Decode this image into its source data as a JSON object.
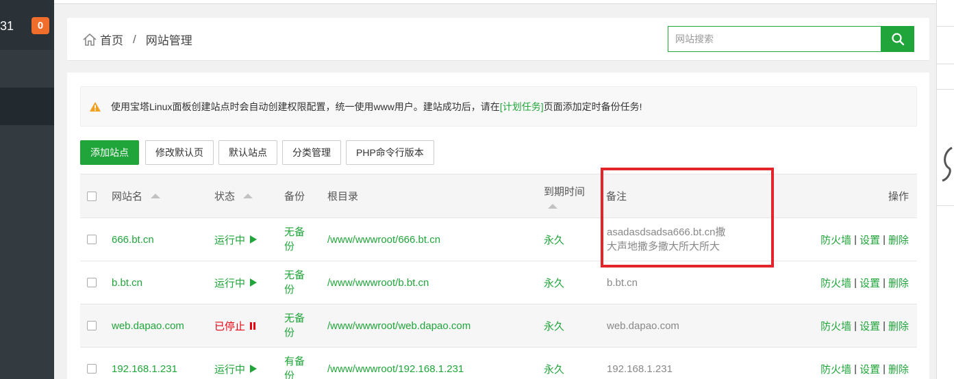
{
  "sidebar": {
    "number": "31",
    "badge": "0"
  },
  "breadcrumb": {
    "home": "首页",
    "separator": "/",
    "current": "网站管理"
  },
  "search": {
    "placeholder": "网站搜索"
  },
  "notice": {
    "text_before": "使用宝塔Linux面板创建站点时会自动创建权限配置，统一使用www用户。建站成功后，请在",
    "link": "[计划任务]",
    "text_after": "页面添加定时备份任务!"
  },
  "toolbar": {
    "add_site": "添加站点",
    "edit_default_page": "修改默认页",
    "default_site": "默认站点",
    "category_manage": "分类管理",
    "php_cli_version": "PHP命令行版本"
  },
  "table": {
    "headers": {
      "name": "网站名",
      "status": "状态",
      "backup": "备份",
      "root": "根目录",
      "expire": "到期时间",
      "remark": "备注",
      "actions": "操作"
    },
    "rows": [
      {
        "name": "666.bt.cn",
        "status": "运行中",
        "backup": [
          "无备",
          "份"
        ],
        "root": "/www/wwwroot/666.bt.cn",
        "expire": "永久",
        "remark": [
          "asadasdsadsa666.bt.cn撒",
          "大声地撒多撒大所大所大"
        ]
      },
      {
        "name": "b.bt.cn",
        "status": "运行中",
        "backup": [
          "无备",
          "份"
        ],
        "root": "/www/wwwroot/b.bt.cn",
        "expire": "永久",
        "remark": [
          "b.bt.cn",
          ""
        ]
      },
      {
        "name": "web.dapao.com",
        "status": "已停止",
        "backup": [
          "无备",
          "份"
        ],
        "root": "/www/wwwroot/web.dapao.com",
        "expire": "永久",
        "remark": [
          "web.dapao.com",
          ""
        ]
      },
      {
        "name": "192.168.1.231",
        "status": "运行中",
        "backup": [
          "有备",
          "份"
        ],
        "root": "/www/wwwroot/192.168.1.231",
        "expire": "永久",
        "remark": [
          "192.168.1.231",
          ""
        ]
      }
    ],
    "actions": {
      "firewall": "防火墙",
      "settings": "设置",
      "delete": "删除",
      "separator": "|"
    }
  },
  "colors": {
    "accent": "#20a53a",
    "stopped": "#e60012",
    "badge": "#f06d2c",
    "sidebar": "#333a40",
    "highlight_box": "#e3242b"
  }
}
